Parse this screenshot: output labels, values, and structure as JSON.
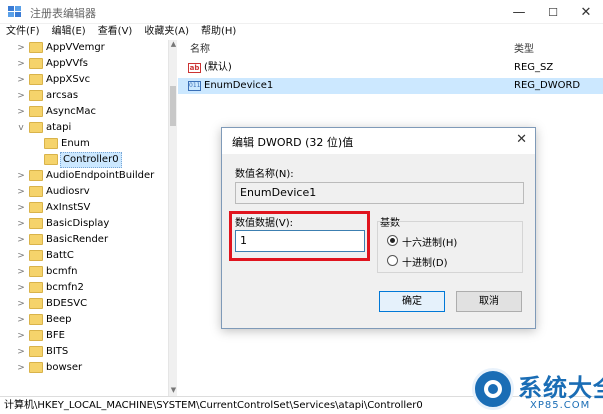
{
  "window": {
    "title": "注册表编辑器",
    "min": "—",
    "max": "☐",
    "close": "✕"
  },
  "menu": [
    "文件(F)",
    "编辑(E)",
    "查看(V)",
    "收藏夹(A)",
    "帮助(H)"
  ],
  "tree": {
    "items": [
      {
        "label": "AppVVemgr",
        "expander": ">"
      },
      {
        "label": "AppVVfs",
        "expander": ">"
      },
      {
        "label": "AppXSvc",
        "expander": ">"
      },
      {
        "label": "arcsas",
        "expander": ">"
      },
      {
        "label": "AsyncMac",
        "expander": ">"
      },
      {
        "label": "atapi",
        "expander": "v"
      },
      {
        "label": "Enum",
        "expander": ""
      },
      {
        "label": "Controller0",
        "expander": ""
      },
      {
        "label": "AudioEndpointBuilder",
        "expander": ">"
      },
      {
        "label": "Audiosrv",
        "expander": ">"
      },
      {
        "label": "AxInstSV",
        "expander": ">"
      },
      {
        "label": "BasicDisplay",
        "expander": ">"
      },
      {
        "label": "BasicRender",
        "expander": ">"
      },
      {
        "label": "BattC",
        "expander": ">"
      },
      {
        "label": "bcmfn",
        "expander": ">"
      },
      {
        "label": "bcmfn2",
        "expander": ">"
      },
      {
        "label": "BDESVC",
        "expander": ">"
      },
      {
        "label": "Beep",
        "expander": ">"
      },
      {
        "label": "BFE",
        "expander": ">"
      },
      {
        "label": "BITS",
        "expander": ">"
      },
      {
        "label": "bowser",
        "expander": ">"
      }
    ],
    "selected": "Controller0"
  },
  "values": {
    "headers": {
      "name": "名称",
      "type": "类型"
    },
    "rows": [
      {
        "icon": "ab",
        "name": "(默认)",
        "type": "REG_SZ"
      },
      {
        "icon": "011",
        "name": "EnumDevice1",
        "type": "REG_DWORD"
      }
    ]
  },
  "dialog": {
    "title": "编辑 DWORD (32 位)值",
    "close": "✕",
    "name_label": "数值名称(N):",
    "name_value": "EnumDevice1",
    "data_label": "数值数据(V):",
    "data_value": "1",
    "base_label": "基数",
    "radio_hex": "十六进制(H)",
    "radio_dec": "十进制(D)",
    "selected_base": "hex",
    "ok": "确定",
    "cancel": "取消"
  },
  "status": "计算机\\HKEY_LOCAL_MACHINE\\SYSTEM\\CurrentControlSet\\Services\\atapi\\Controller0",
  "watermark": {
    "brand": "系统大全",
    "url": "XP85.COM"
  },
  "colors": {
    "selection": "#cce8ff",
    "highlight_box": "#e0141e",
    "folder": "#f5d36b",
    "brand": "#1a6db5"
  }
}
